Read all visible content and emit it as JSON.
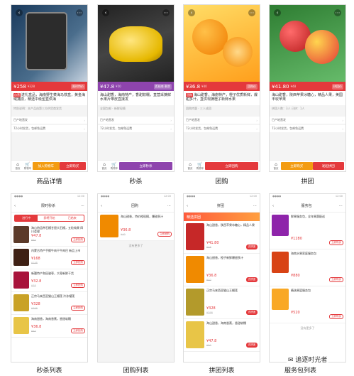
{
  "screens_top": [
    {
      "caption": "商品详情",
      "price": "¥258",
      "old": "¥328",
      "tag": "限时特价",
      "title": "进礼盒品，海南野生菜海马铁盒，黄金海域捕捞，精选中级型直供海",
      "note": "特别说明：本产品由第三方供货商发货",
      "row1": "已产地直发",
      "row2": "72小时发货，包邮免运费"
    },
    {
      "caption": "秒杀",
      "price": "¥47.8",
      "old": "¥50",
      "tag": "距结束 剩余",
      "title": "海山甜香，海南特产，香甜软糯，直营采摘鲜水果片带皮直接发",
      "note": "全国包邮 · 新鲜现摘",
      "row1": "已产地直发",
      "row2": "72小时发货，包邮免运费"
    },
    {
      "caption": "团购",
      "price": "¥36.8",
      "old": "¥40",
      "tag": "团购价",
      "title": "海山甜香，海南特产，橙子优质新鲜，爆甜多汁，直供现摘橙子新鲜水果",
      "note": "团购特惠 · 三人成团",
      "row1": "已产地直发",
      "row2": "72小时发货，包邮免运费"
    },
    {
      "caption": "拼团",
      "price": "¥41.80",
      "old": "¥48",
      "tag": "拼团价",
      "title": "海山甜香，陕西苹果冰糖心，精品人果，美国丰收苹果",
      "note": "拼团人数：3人 已拼：1人",
      "row1": "已产地直发",
      "row2": "72小时发货，包邮免运费"
    }
  ],
  "bottom_captions": [
    "秒杀列表",
    "团购列表",
    "拼团列表",
    "服务包列表"
  ],
  "seckill_list": {
    "title": "限时秒杀",
    "tabs": [
      "进行中",
      "即将开始",
      "已结束"
    ],
    "items": [
      {
        "title": "海山特品种石榴甘胆大石榴，五粒纯果 四川会理",
        "price": "¥47.8",
        "old": "¥50",
        "btn": "立即抢购"
      },
      {
        "title": "内蒙古特产手撕牛肉干牛肉巴 新品上市",
        "price": "¥168",
        "old": "¥198",
        "btn": "立即抢购"
      },
      {
        "title": "新疆特产和田骏枣，大枣新鲜干货",
        "price": "¥32.8",
        "old": "¥38",
        "btn": "立即抢购"
      },
      {
        "title": "正宗马来西亚猫山王榴莲 冷冻榴莲",
        "price": "¥328",
        "old": "¥398",
        "btn": "立即抢购"
      },
      {
        "title": "海南甜香，海南香蕉，香甜软糯",
        "price": "¥36.8",
        "old": "¥40",
        "btn": "立即抢购"
      }
    ]
  },
  "group_list": {
    "title": "团购",
    "item_title": "海山甜香，特价橙现摘，爆甜多汁",
    "price": "¥36.8",
    "old": "¥40",
    "btn": "立即团购",
    "end": "没有更多了"
  },
  "pin_list": {
    "title": "拼团",
    "banner": "精选拼团",
    "items": [
      {
        "title": "海山甜香，陕西苹果冰糖心，精品人果",
        "price": "¥41.80",
        "old": "¥48",
        "btn": "去拼团"
      },
      {
        "title": "海山甜香，橙子新鲜爆甜多汁",
        "price": "¥36.8",
        "old": "¥40",
        "btn": "去拼团"
      },
      {
        "title": "正宗马来西亚猫山王榴莲",
        "price": "¥328",
        "old": "¥398",
        "btn": "去拼团"
      },
      {
        "title": "海山甜香，海南香蕉，香甜软糯",
        "price": "¥47.8",
        "old": "¥50",
        "btn": "去拼团"
      }
    ]
  },
  "service_list": {
    "title": "服务包",
    "items": [
      {
        "title": "鲜果服务包，全年果蔬配送",
        "price": "¥1280",
        "btn": "立即购买"
      },
      {
        "title": "海南水果家庭服务包",
        "price": "¥880",
        "btn": "立即购买"
      },
      {
        "title": "精选果篮服务包",
        "price": "¥520",
        "btn": "立即购买"
      }
    ],
    "end": "没有更多了"
  },
  "tabbar": {
    "home": "首页",
    "cart": "购物车",
    "service": "客服"
  },
  "cta": {
    "single": "加入购物车",
    "buy": "立即购买",
    "seckill": "立即秒杀",
    "group": "立即团购",
    "pin": "发起拼团"
  },
  "watermark": "追逐时光者",
  "colors": {
    "accent": "#e4393c",
    "purple": "#8e44ad",
    "orange": "#f39c12"
  }
}
